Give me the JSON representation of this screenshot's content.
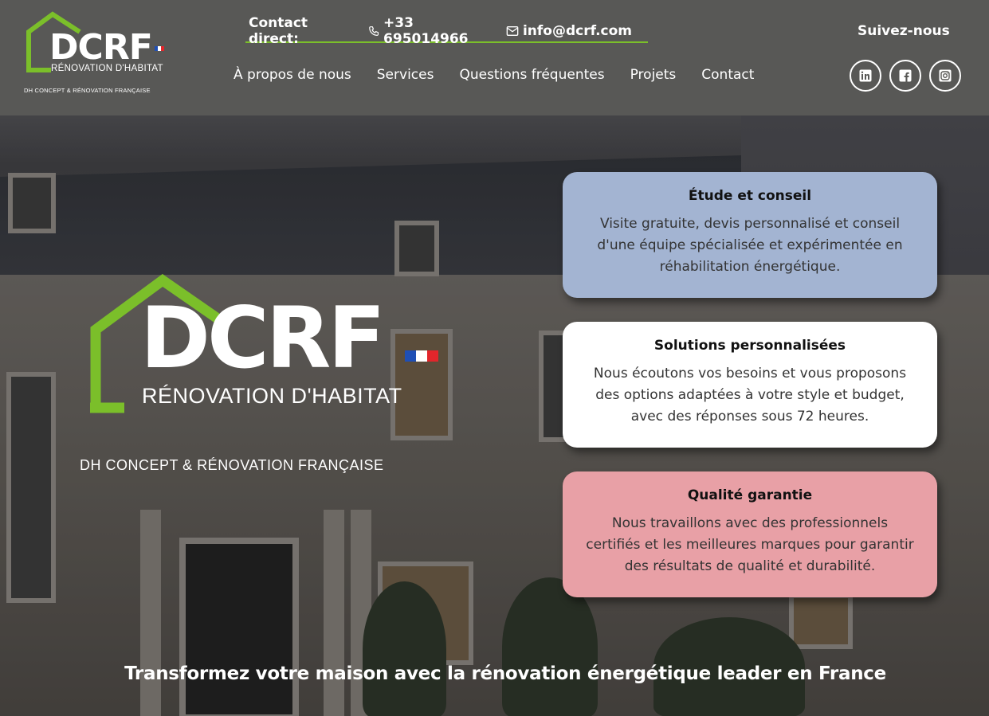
{
  "brand": {
    "logo_text": "DCRF",
    "logo_subtitle": "RÉNOVATION D'HABITAT",
    "logo_tagline": "DH CONCEPT & RÉNOVATION FRANÇAISE",
    "colors": {
      "accent_green": "#7bbf2a",
      "header_bg": "#585856",
      "flag_blue": "#1f4fb5",
      "flag_white": "#ffffff",
      "flag_red": "#e2262b"
    }
  },
  "header": {
    "contact_label": "Contact direct:",
    "phone": "+33 695014966",
    "phone_icon": "phone-icon",
    "email": "info@dcrf.com",
    "email_icon": "mail-icon",
    "nav": [
      "À propos de nous",
      "Services",
      "Questions fréquentes",
      "Projets",
      "Contact"
    ],
    "follow_label": "Suivez-nous",
    "socials": [
      "linkedin-icon",
      "facebook-icon",
      "instagram-icon"
    ]
  },
  "hero": {
    "cards": [
      {
        "title": "Étude et conseil",
        "text": "Visite gratuite, devis personnalisé et conseil d'une équipe spécialisée et expérimentée en réhabilitation énergétique.",
        "bg": "#a3b4d2"
      },
      {
        "title": "Solutions personnalisées",
        "text": "Nous écoutons vos besoins et vous proposons des options adaptées à votre style et budget, avec des réponses sous 72 heures.",
        "bg": "#ffffff"
      },
      {
        "title": "Qualité garantie",
        "text": "Nous travaillons avec des professionnels certifiés et les meilleures marques pour garantir des résultats de qualité et durabilité.",
        "bg": "#e8a0a6"
      }
    ],
    "tagline": "Transformez votre maison avec la rénovation énergétique leader en France"
  }
}
